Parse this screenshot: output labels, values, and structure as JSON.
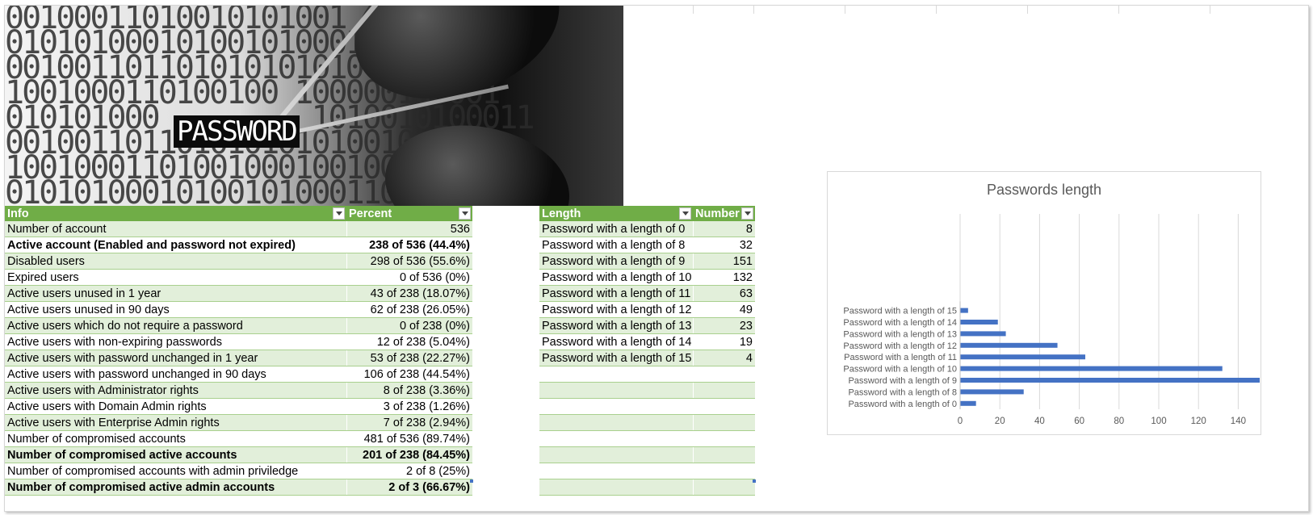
{
  "banner": {
    "label": "PASSWORD",
    "binary_lines": [
      "00100011010010101001",
      "0101010001010010100011",
      "001001101101010101010",
      "1001000110100100 100000100001",
      "010101000         1010010100011",
      "001001101101010101010010",
      "1001000110100100010010001",
      "0101010001010010100011000"
    ]
  },
  "info_table": {
    "headers": [
      "Info",
      "Percent"
    ],
    "rows": [
      {
        "info": "Number of account",
        "percent": "536",
        "bold": false
      },
      {
        "info": "Active account (Enabled and password not expired)",
        "percent": "238 of 536 (44.4%)",
        "bold": true
      },
      {
        "info": "Disabled users",
        "percent": "298 of 536 (55.6%)",
        "bold": false
      },
      {
        "info": "Expired users",
        "percent": "0 of 536 (0%)",
        "bold": false
      },
      {
        "info": "Active users unused in 1 year",
        "percent": "43 of 238 (18.07%)",
        "bold": false
      },
      {
        "info": "Active users unused in 90 days",
        "percent": "62 of 238 (26.05%)",
        "bold": false
      },
      {
        "info": "Active users which do not require a password",
        "percent": "0 of 238 (0%)",
        "bold": false
      },
      {
        "info": "Active users with non-expiring passwords",
        "percent": "12 of 238 (5.04%)",
        "bold": false
      },
      {
        "info": "Active users with password unchanged in 1 year",
        "percent": "53 of 238 (22.27%)",
        "bold": false
      },
      {
        "info": "Active users with password unchanged in 90 days",
        "percent": "106 of 238 (44.54%)",
        "bold": false
      },
      {
        "info": "Active users with Administrator rights",
        "percent": "8 of 238 (3.36%)",
        "bold": false
      },
      {
        "info": "Active users with Domain Admin rights",
        "percent": "3 of 238 (1.26%)",
        "bold": false
      },
      {
        "info": "Active users with Enterprise Admin rights",
        "percent": "7 of 238 (2.94%)",
        "bold": false
      },
      {
        "info": "Number of compromised accounts",
        "percent": "481 of 536 (89.74%)",
        "bold": false
      },
      {
        "info": "Number of compromised active accounts",
        "percent": "201 of 238 (84.45%)",
        "bold": true
      },
      {
        "info": "Number of compromised accounts with admin priviledge",
        "percent": "2 of 8 (25%)",
        "bold": false
      },
      {
        "info": "Number of compromised active admin accounts",
        "percent": "2 of 3 (66.67%)",
        "bold": true
      }
    ]
  },
  "length_table": {
    "headers": [
      "Length",
      "Number"
    ],
    "rows": [
      {
        "length": "Password with a length of 0",
        "number": "8"
      },
      {
        "length": "Password with a length of 8",
        "number": "32"
      },
      {
        "length": "Password with a length of 9",
        "number": "151"
      },
      {
        "length": "Password with a length of 10",
        "number": "132"
      },
      {
        "length": "Password with a length of 11",
        "number": "63"
      },
      {
        "length": "Password with a length of 12",
        "number": "49"
      },
      {
        "length": "Password with a length of 13",
        "number": "23"
      },
      {
        "length": "Password with a length of 14",
        "number": "19"
      },
      {
        "length": "Password with a length of 15",
        "number": "4"
      },
      {
        "length": "",
        "number": ""
      },
      {
        "length": "",
        "number": ""
      },
      {
        "length": "",
        "number": ""
      },
      {
        "length": "",
        "number": ""
      },
      {
        "length": "",
        "number": ""
      },
      {
        "length": "",
        "number": ""
      },
      {
        "length": "",
        "number": ""
      },
      {
        "length": "",
        "number": ""
      }
    ]
  },
  "colors": {
    "header_green": "#70ad47",
    "band_green": "#e2efda",
    "bar_blue": "#4472c4"
  },
  "chart_data": {
    "type": "bar",
    "orientation": "horizontal",
    "title": "Passwords length",
    "categories": [
      "Password with a length of 0",
      "Password with a length of 8",
      "Password with a length of 9",
      "Password with a length of 10",
      "Password with a length of 11",
      "Password with a length of 12",
      "Password with a length of 13",
      "Password with a length of 14",
      "Password with a length of 15"
    ],
    "values": [
      8,
      32,
      151,
      132,
      63,
      49,
      23,
      19,
      4
    ],
    "xlim": [
      0,
      150
    ],
    "xticks": [
      0,
      20,
      40,
      60,
      80,
      100,
      120,
      140
    ],
    "grid": true,
    "legend": "none"
  }
}
